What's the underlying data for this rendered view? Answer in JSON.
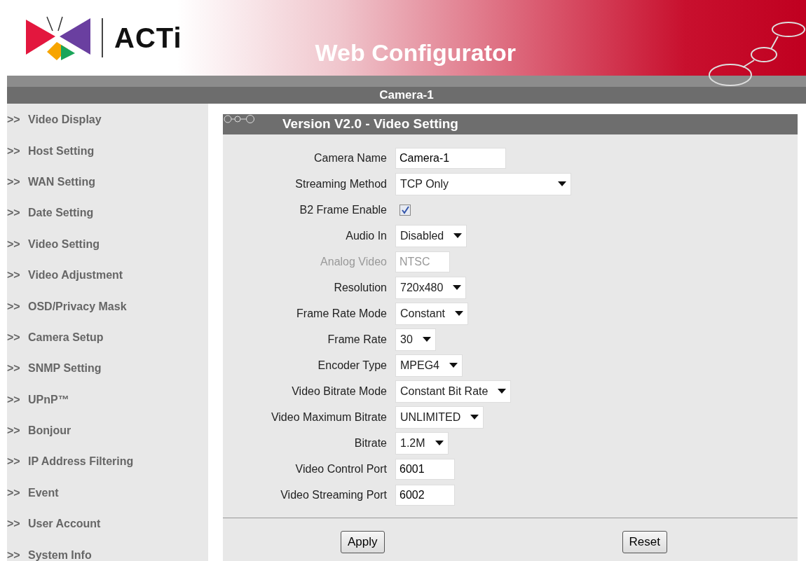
{
  "header": {
    "logo_text": "ACTi",
    "title": "Web Configurator"
  },
  "device_bar": {
    "name": "Camera-1"
  },
  "sidebar": {
    "items": [
      {
        "arrow": ">>",
        "label": "Video Display",
        "selected": false
      },
      {
        "arrow": ">>",
        "label": "Host Setting",
        "selected": false
      },
      {
        "arrow": ">>",
        "label": "WAN Setting",
        "selected": false
      },
      {
        "arrow": ">>",
        "label": "Date Setting",
        "selected": false
      },
      {
        "arrow": ">>",
        "label": "Video Setting",
        "selected": false
      },
      {
        "arrow": ">>",
        "label": "Video Adjustment",
        "selected": false
      },
      {
        "arrow": ">>",
        "label": "OSD/Privacy Mask",
        "selected": false
      },
      {
        "arrow": ">>",
        "label": "Camera Setup",
        "selected": false
      },
      {
        "arrow": ">>",
        "label": "SNMP Setting",
        "selected": false
      },
      {
        "arrow": ">>",
        "label": "UPnP™",
        "selected": false
      },
      {
        "arrow": ">>",
        "label": "Bonjour",
        "selected": false
      },
      {
        "arrow": ">>",
        "label": "IP Address Filtering",
        "selected": false
      },
      {
        "arrow": ">>",
        "label": "Event",
        "selected": false
      },
      {
        "arrow": ">>",
        "label": "User Account",
        "selected": false
      },
      {
        "arrow": ">>",
        "label": "System Info",
        "selected": false
      }
    ]
  },
  "panel": {
    "title": "Version V2.0 - Video Setting",
    "fields": [
      {
        "kind": "text",
        "label": "Camera Name",
        "value": "Camera-1",
        "disabled": false
      },
      {
        "kind": "select",
        "label": "Streaming Method",
        "value": "TCP Only",
        "disabled": false
      },
      {
        "kind": "checkbox",
        "label": "B2 Frame Enable",
        "checked": true,
        "disabled": false
      },
      {
        "kind": "select",
        "label": "Audio In",
        "value": "Disabled",
        "disabled": false
      },
      {
        "kind": "text",
        "label": "Analog Video",
        "value": "NTSC",
        "disabled": true
      },
      {
        "kind": "select",
        "label": "Resolution",
        "value": "720x480",
        "disabled": false
      },
      {
        "kind": "select",
        "label": "Frame Rate Mode",
        "value": "Constant",
        "disabled": false
      },
      {
        "kind": "select",
        "label": "Frame Rate",
        "value": "30",
        "disabled": false
      },
      {
        "kind": "select",
        "label": "Encoder Type",
        "value": "MPEG4",
        "disabled": false
      },
      {
        "kind": "select",
        "label": "Video Bitrate Mode",
        "value": "Constant Bit Rate",
        "disabled": false
      },
      {
        "kind": "select",
        "label": "Video Maximum Bitrate",
        "value": "UNLIMITED",
        "disabled": false
      },
      {
        "kind": "select",
        "label": "Bitrate",
        "value": "1.2M",
        "disabled": false
      },
      {
        "kind": "text",
        "label": "Video Control Port",
        "value": "6001",
        "disabled": false
      },
      {
        "kind": "text",
        "label": "Video Streaming Port",
        "value": "6002",
        "disabled": false
      }
    ],
    "buttons": [
      "Apply",
      "Reset"
    ]
  }
}
